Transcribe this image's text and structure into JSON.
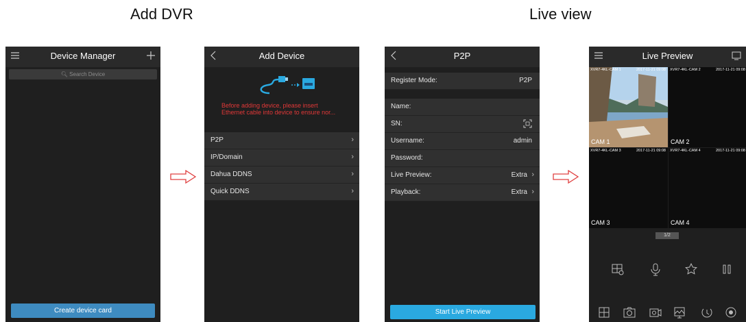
{
  "captions": {
    "add_dvr": "Add DVR",
    "live_view": "Live view"
  },
  "device_manager": {
    "title": "Device Manager",
    "search_placeholder": "Search Device",
    "create_button": "Create device card"
  },
  "add_device": {
    "title": "Add Device",
    "warning_line1": "Before adding device, please insert",
    "warning_line2": "Ethernet cable into device to ensure nor...",
    "options": [
      "P2P",
      "IP/Domain",
      "Dahua DDNS",
      "Quick DDNS"
    ]
  },
  "p2p": {
    "title": "P2P",
    "register_mode_label": "Register Mode:",
    "register_mode_value": "P2P",
    "name_label": "Name:",
    "sn_label": "SN:",
    "username_label": "Username:",
    "username_value": "admin",
    "password_label": "Password:",
    "live_preview_label": "Live Preview:",
    "live_preview_value": "Extra",
    "playback_label": "Playback:",
    "playback_value": "Extra",
    "start_button": "Start Live Preview"
  },
  "live_preview": {
    "title": "Live Preview",
    "pager": "1/2",
    "cameras": [
      {
        "name": "XVR7-4KL-CAM 1",
        "time": "2017-11-21 09:08",
        "label": "CAM 1"
      },
      {
        "name": "XVR7-4KL-CAM 2",
        "time": "2017-11-21 09:08",
        "label": "CAM 2"
      },
      {
        "name": "XVR7-4KL-CAM 3",
        "time": "2017-11-21 09:08",
        "label": "CAM 3"
      },
      {
        "name": "XVR7-4KL-CAM 4",
        "time": "2017-11-21 09:08",
        "label": "CAM 4"
      }
    ]
  },
  "colors": {
    "accent_blue": "#2aa9e0",
    "button_blue": "#2b8ed0",
    "warning_red": "#e23838",
    "arrow_red": "#e04040"
  }
}
